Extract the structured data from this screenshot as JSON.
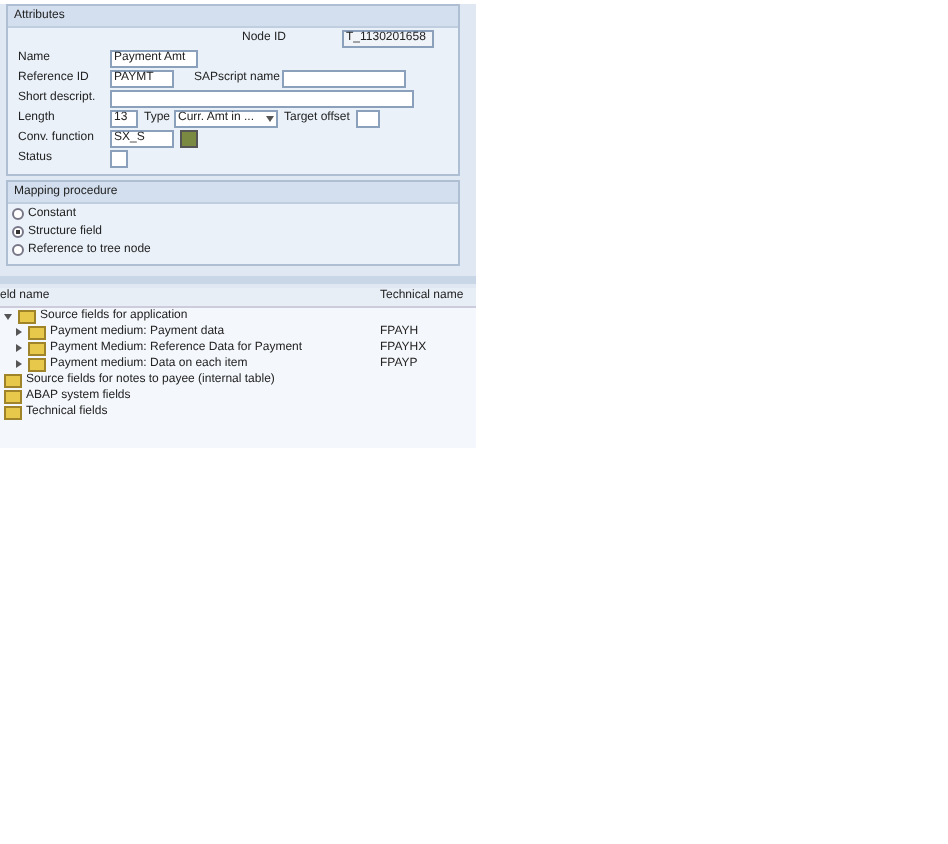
{
  "attributes": {
    "title": "Attributes",
    "node_id_label": "Node ID",
    "node_id": "T_1130201658",
    "name_label": "Name",
    "name": "Payment Amt",
    "reference_id_label": "Reference ID",
    "reference_id": "PAYMT",
    "sapscript_label": "SAPscript name",
    "short_descript_label": "Short descript.",
    "length_label": "Length",
    "length": "13",
    "type_label": "Type",
    "type": "Curr. Amt in ...",
    "target_offset_label": "Target offset",
    "conv_function_label": "Conv. function",
    "conv_function": "SX_S",
    "status_label": "Status",
    "status_checked": false
  },
  "mapping": {
    "title": "Mapping procedure",
    "options": [
      {
        "label": "Constant",
        "selected": false
      },
      {
        "label": "Structure field",
        "selected": true
      },
      {
        "label": "Reference to tree node",
        "selected": false
      }
    ]
  },
  "tree": {
    "columns": [
      "eld name",
      "Technical name"
    ],
    "nodes": [
      {
        "label": "Source fields for application",
        "expanded": true,
        "children": [
          {
            "label": "Payment medium: Payment data",
            "technical_name": "FPAYH",
            "expanded": false
          },
          {
            "label": "Payment Medium: Reference Data for Payment",
            "technical_name": "FPAYHX",
            "expanded": false
          },
          {
            "label": "Payment medium: Data on each item",
            "technical_name": "FPAYP",
            "expanded": false
          }
        ]
      },
      {
        "label": "Source fields for notes to payee (internal table)"
      },
      {
        "label": "ABAP system fields"
      },
      {
        "label": "Technical fields"
      }
    ]
  }
}
